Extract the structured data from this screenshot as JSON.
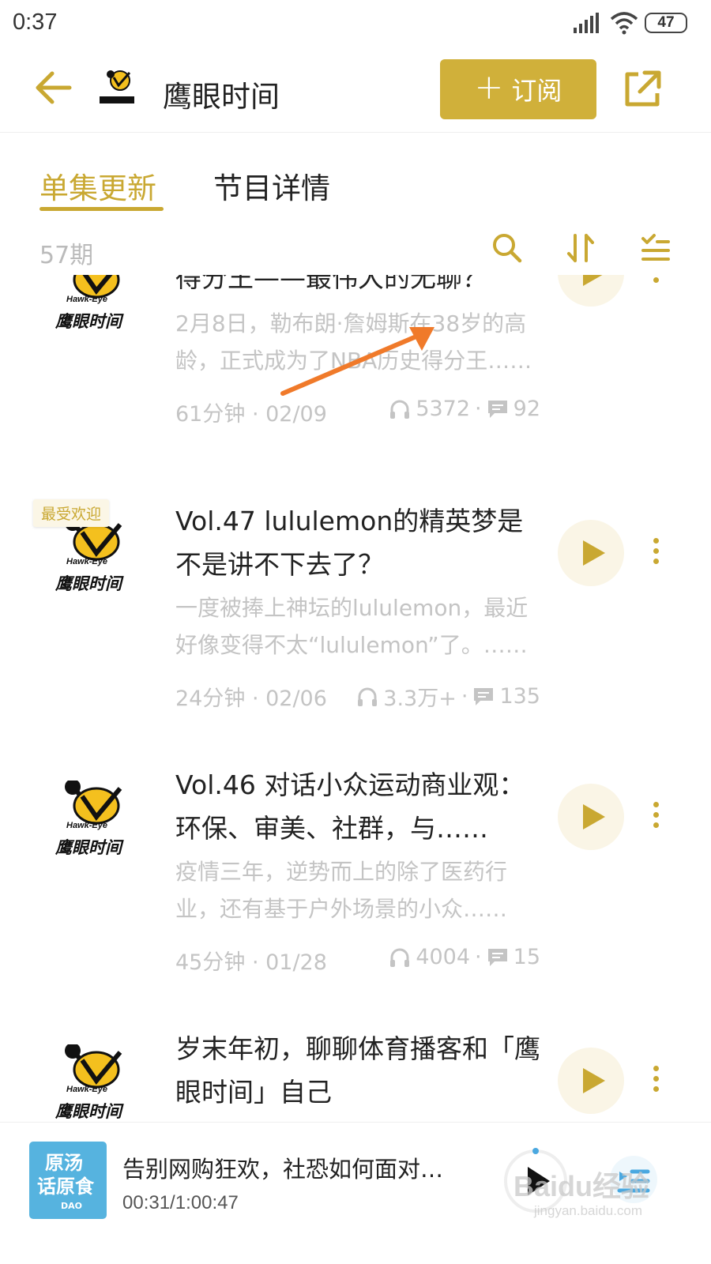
{
  "status_bar": {
    "time": "0:37",
    "battery": "47"
  },
  "header": {
    "title": "鹰眼时间",
    "subscribe_label": "订阅",
    "logo_text": "鹰眼时间"
  },
  "tabs": [
    {
      "label": "单集更新",
      "active": true
    },
    {
      "label": "节目详情",
      "active": false
    }
  ],
  "toolbar": {
    "episode_count": "57期"
  },
  "episodes": [
    {
      "title": "得分王——最伟大的无聊？",
      "description": "2月8日，勒布朗·詹姆斯在38岁的高龄，正式成为了NBA历史得分王……",
      "duration_date": "61分钟 · 02/09",
      "plays": "5372",
      "comments": "92",
      "logo_brand": "Hawk-Eye",
      "logo_cn": "鹰眼时间"
    },
    {
      "badge": "最受欢迎",
      "title": "Vol.47 lululemon的精英梦是不是讲不下去了？",
      "description": "一度被捧上神坛的lululemon，最近好像变得不太“lululemon”了。……",
      "duration_date": "24分钟 · 02/06",
      "plays": "3.3万+",
      "comments": "135",
      "logo_brand": "Hawk-Eye",
      "logo_cn": "鹰眼时间"
    },
    {
      "title": "Vol.46 对话小众运动商业观：环保、审美、社群，与……",
      "description": "疫情三年，逆势而上的除了医药行业，还有基于户外场景的小众……",
      "duration_date": "45分钟 · 01/28",
      "plays": "4004",
      "comments": "15",
      "logo_brand": "Hawk-Eye",
      "logo_cn": "鹰眼时间"
    },
    {
      "title": "岁末年初，聊聊体育播客和「鹰眼时间」自己",
      "logo_brand": "Hawk-Eye",
      "logo_cn": "鹰眼时间"
    }
  ],
  "mini_player": {
    "title": "告别网购狂欢，社恐如何面对…",
    "time": "00:31/1:00:47",
    "cover_text": [
      "原汤",
      "话原食"
    ],
    "cover_brand": "DAO"
  },
  "watermark": {
    "brand": "Baidu经验",
    "site": "jingyan.baidu.com"
  },
  "colors": {
    "accent": "#c9a832",
    "button": "#d0b03a",
    "play_bg": "#faf5e6",
    "annotation_arrow": "#f07a2a"
  }
}
